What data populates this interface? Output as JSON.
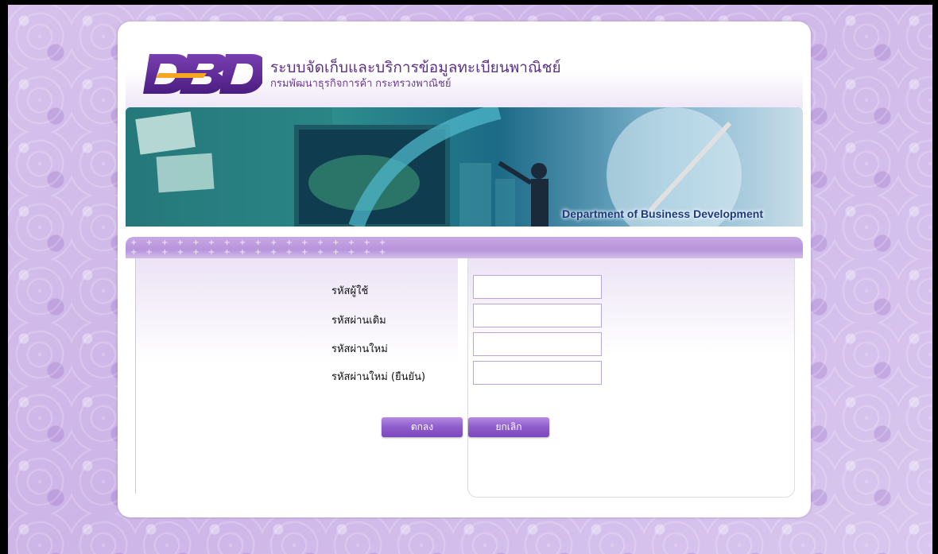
{
  "header": {
    "logo_text": "DBD",
    "title": "ระบบจัดเก็บและบริการข้อมูลทะเบียนพาณิชย์",
    "subtitle": "กรมพัฒนาธุรกิจการค้า กระทรวงพาณิชย์"
  },
  "banner": {
    "caption": "Department of Business Development"
  },
  "form": {
    "username_label": "รหัสผู้ใช้",
    "old_password_label": "รหัสผ่านเดิม",
    "new_password_label": "รหัสผ่านใหม่",
    "confirm_password_label": "รหัสผ่านใหม่ (ยืนยัน)",
    "username_value": "",
    "old_password_value": "",
    "new_password_value": "",
    "confirm_password_value": ""
  },
  "buttons": {
    "ok": "ตกลง",
    "cancel": "ยกเลิก"
  },
  "colors": {
    "accent": "#8e5ccc",
    "background": "#d6c2ec",
    "title": "#5b2f8a"
  }
}
